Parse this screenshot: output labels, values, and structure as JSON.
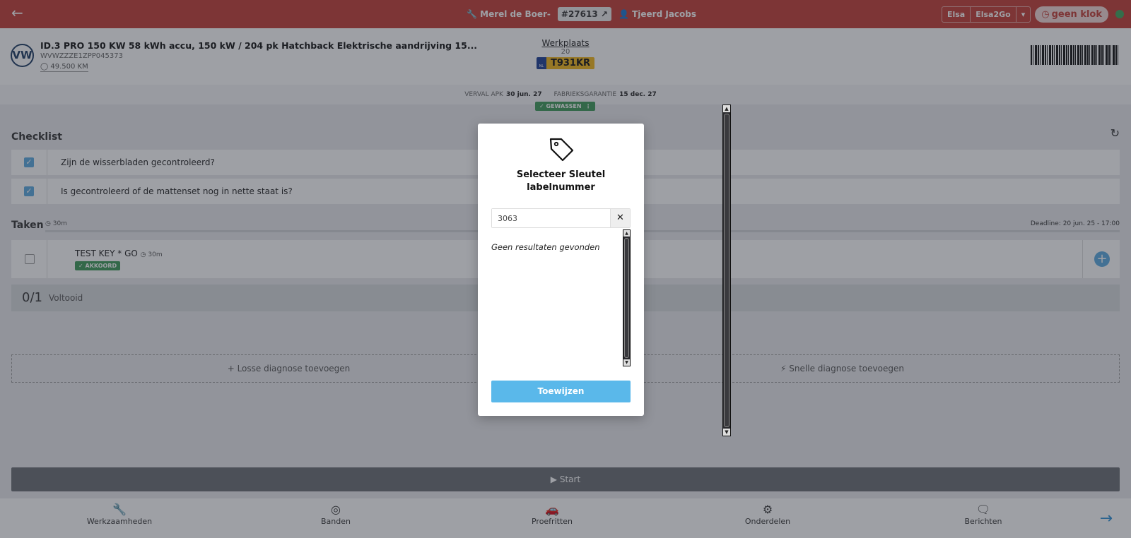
{
  "topbar": {
    "mechanic": "Merel de Boer-",
    "order": "#27613",
    "advisor": "Tjeerd Jacobs",
    "elsa": "Elsa",
    "elsa2go": "Elsa2Go",
    "klok": "geen klok",
    "status_color": "#3fa55c"
  },
  "vehicle": {
    "logo": "VW",
    "title": "ID.3 PRO 150 KW 58 kWh accu, 150 kW / 204 pk Hatchback Elektrische aandrijving 15...",
    "vin": "WVWZZZE1ZPP045373",
    "mileage": "49.500 KM",
    "location_label": "Werkplaats",
    "location_number": "20",
    "plate_country": "NL",
    "plate": "T931KR"
  },
  "apk": {
    "apk_label": "VERVAL APK",
    "apk_date": "30 jun. 27",
    "warranty_label": "FABRIEKSGARANTIE",
    "warranty_date": "15 dec. 27",
    "washed": "GEWASSEN"
  },
  "checklist": {
    "title": "Checklist",
    "items": [
      {
        "label": "Zijn de wisserbladen gecontroleerd?"
      },
      {
        "label": "Is gecontroleerd of de mattenset nog in nette staat is?"
      }
    ]
  },
  "taken": {
    "title": "Taken",
    "duration": "30m",
    "deadline": "Deadline: 20 jun. 25 - 17:00",
    "task_name": "TEST KEY * GO",
    "task_duration": "30m",
    "task_status": "AKKOORD",
    "progress_count": "0/1",
    "progress_label": "Voltooid"
  },
  "diagnosis": {
    "loose": "Losse diagnose toevoegen",
    "quick": "Snelle diagnose toevoegen"
  },
  "start_label": "Start",
  "bottomnav": {
    "items": [
      {
        "label": "Werkzaamheden"
      },
      {
        "label": "Banden"
      },
      {
        "label": "Proefritten"
      },
      {
        "label": "Onderdelen"
      },
      {
        "label": "Berichten"
      }
    ]
  },
  "modal": {
    "title_line1": "Selecteer Sleutel",
    "title_line2": "labelnummer",
    "search_value": "3063",
    "no_results": "Geen resultaten gevonden",
    "assign_label": "Toewijzen"
  },
  "colors": {
    "brand": "#c43d35",
    "accent": "#5ab8ea",
    "success": "#3d9a58"
  }
}
